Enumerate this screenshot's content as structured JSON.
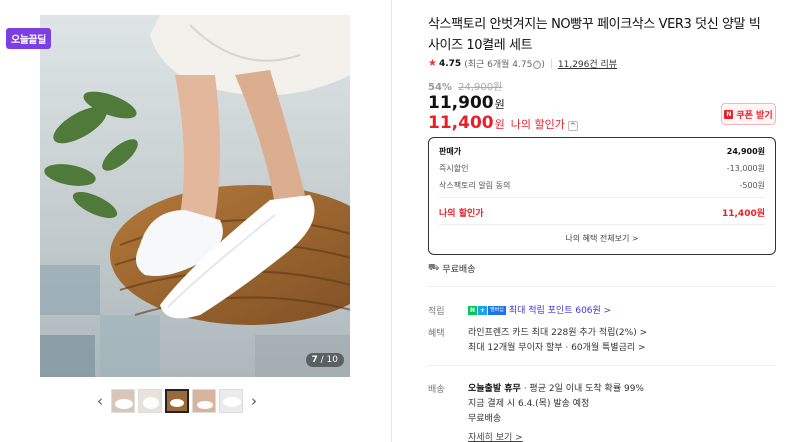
{
  "badge": {
    "today": "오늘끝딜"
  },
  "gallery": {
    "current": "7",
    "total": "/ 10",
    "prev_icon": "chevron-left-icon",
    "next_icon": "chevron-right-icon",
    "thumbnail_count": 5,
    "active_thumbnail": 3
  },
  "product": {
    "title": "삭스팩토리 안벗겨지는 NO빵꾸 페이크삭스 VER3 덧신 양말 빅사이즈 10켤레 세트",
    "rating": "4.75",
    "rating_sub": "(최근 6개월 4.75",
    "rating_sub_close": ")",
    "info_icon": "ⓘ",
    "reviews": "11,296건 리뷰"
  },
  "price": {
    "discount_pct": "54%",
    "original": "24,900원",
    "sale": "11,900",
    "unit": "원",
    "my_price": "11,400",
    "my_price_unit": "원",
    "my_price_label": "나의 할인가",
    "toggle": "^",
    "coupon_icon": "N",
    "coupon_label": "쿠폰 받기"
  },
  "breakdown": {
    "rows": [
      {
        "label": "판매가",
        "value": "24,900원"
      },
      {
        "label": "즉시할인",
        "value": "-13,000원"
      },
      {
        "label": "삭스팩토리 알림 동의",
        "value": "-500원"
      }
    ],
    "total_label": "나의 할인가",
    "total_value": "11,400원",
    "more": "나의 혜택 전체보기 >"
  },
  "shipping_badge": "무료배송",
  "points": {
    "label": "적립",
    "npay_n": "N",
    "npay_plus": "+",
    "npay_text": "멤버십",
    "text": "최대 적립 포인트 606원 >"
  },
  "benefits": {
    "label": "혜택",
    "line1": "라인프렌즈 카드 최대 228원 추가 적립(2%) >",
    "line2": "최대 12개월 무이자 할부 · 60개월 특별금리 >"
  },
  "delivery": {
    "label": "배송",
    "line1_bold": "오늘출발 휴무",
    "line1_rest": "· 평균 2일 이내 도착 확률 99%",
    "line2": "지금 결제 시 6.4.(목) 발송 예정",
    "line3": "무료배송",
    "more": "자세히 보기 >"
  },
  "colors": {
    "accent_red": "#e8202a",
    "badge_purple": "#7b3fe4",
    "link_blue": "#3b36d0"
  }
}
